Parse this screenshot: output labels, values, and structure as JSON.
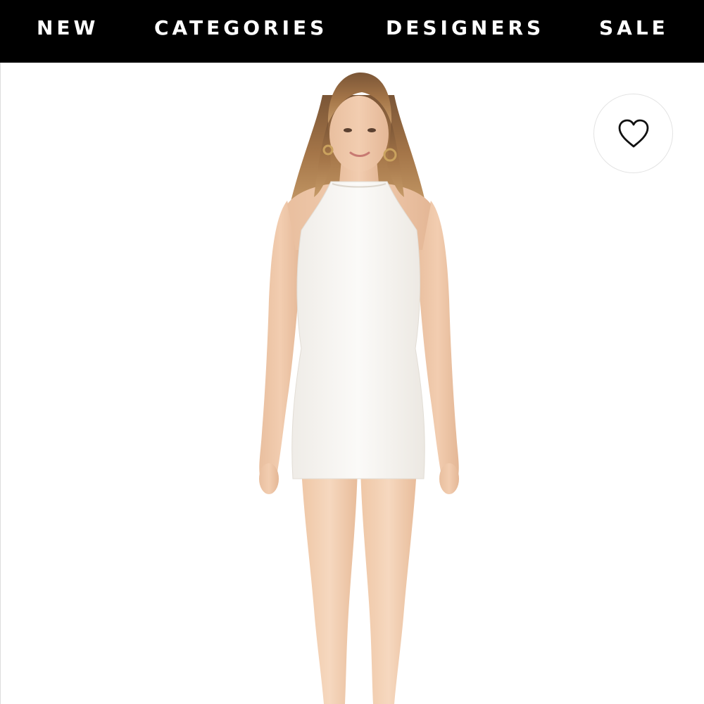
{
  "nav": {
    "items": [
      {
        "label": "NEW"
      },
      {
        "label": "CATEGORIES"
      },
      {
        "label": "DESIGNERS"
      },
      {
        "label": "SALE"
      }
    ]
  },
  "product": {
    "image": {
      "subject": "model wearing white sleeveless halter mini dress"
    },
    "favorite": {
      "icon": "heart-outline-icon"
    }
  },
  "colors": {
    "nav_background": "#000000",
    "nav_text": "#ffffff",
    "page_background": "#ffffff"
  }
}
